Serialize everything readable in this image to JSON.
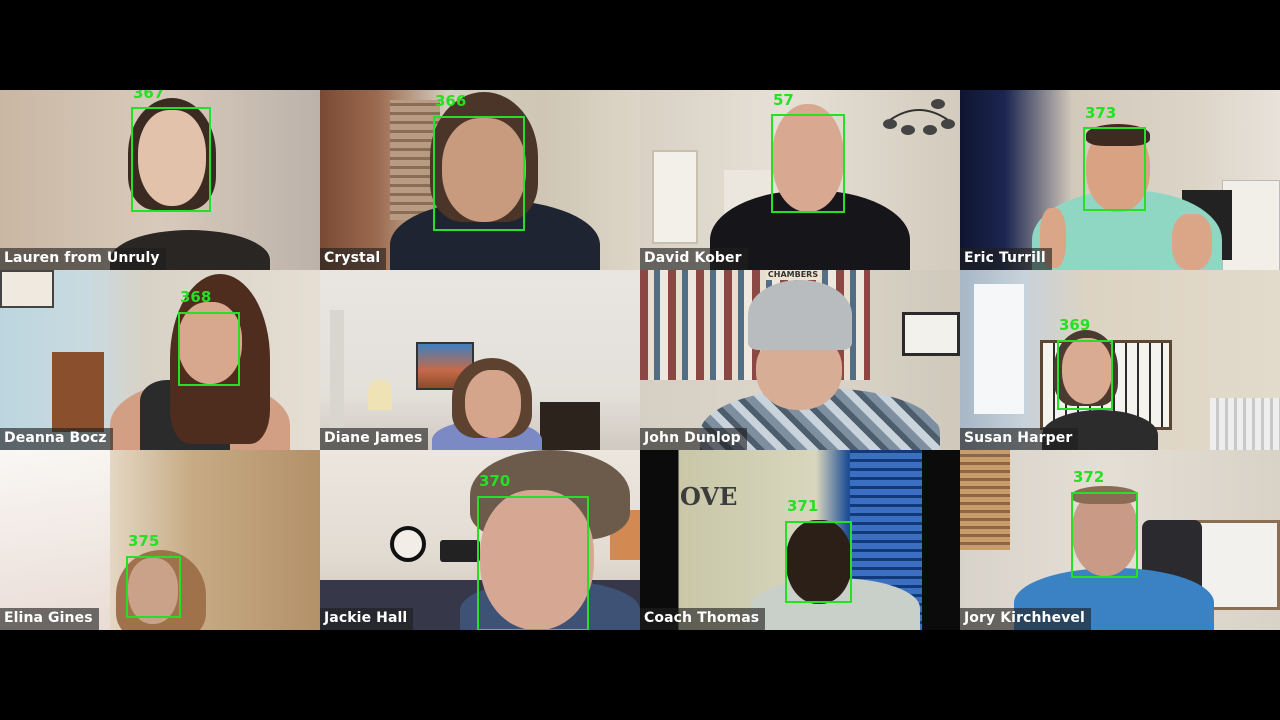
{
  "meeting": {
    "participants": [
      {
        "name": "Lauren from Unruly",
        "face_id": "367"
      },
      {
        "name": "Crystal",
        "face_id": "366"
      },
      {
        "name": "David Kober",
        "face_id": "57"
      },
      {
        "name": "Eric Turrill",
        "face_id": "373"
      },
      {
        "name": "Deanna Bocz",
        "face_id": "368"
      },
      {
        "name": "Diane James",
        "face_id": ""
      },
      {
        "name": "John Dunlop",
        "face_id": ""
      },
      {
        "name": "Susan Harper",
        "face_id": "369"
      },
      {
        "name": "Elina Gines",
        "face_id": "375"
      },
      {
        "name": "Jackie Hall",
        "face_id": "370"
      },
      {
        "name": "Coach Thomas",
        "face_id": "371"
      },
      {
        "name": "Jory Kirchhevel",
        "face_id": "372"
      }
    ],
    "wall_text": {
      "love": "OVE",
      "champions": "CHAMBERS"
    }
  },
  "colors": {
    "face_box": "#25e025",
    "name_bar": "rgba(30,30,30,0.62)"
  }
}
